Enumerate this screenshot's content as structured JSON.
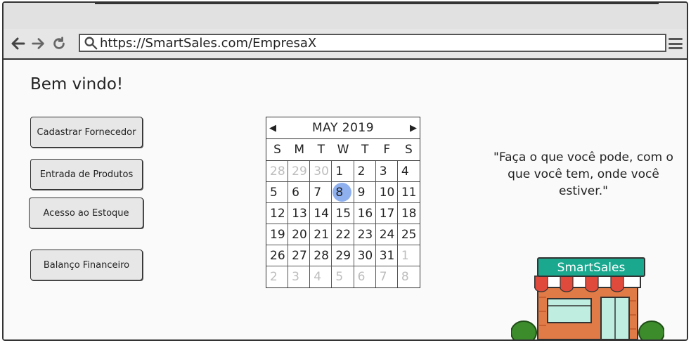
{
  "browser": {
    "url": "https://SmartSales.com/EmpresaX"
  },
  "page": {
    "welcome": "Bem vindo!",
    "buttons": [
      {
        "label": "Cadastrar Fornecedor"
      },
      {
        "label": "Entrada de Produtos"
      },
      {
        "label": "Acesso ao Estoque"
      },
      {
        "label": "Balanço Financeiro"
      }
    ],
    "quote": "\"Faça o que você pode, com o que você tem, onde você estiver.\"",
    "logo_text": "SmartSales"
  },
  "calendar": {
    "month_label": "MAY 2019",
    "weekdays": [
      "S",
      "M",
      "T",
      "W",
      "T",
      "F",
      "S"
    ],
    "weeks": [
      [
        "28",
        "29",
        "30",
        "1",
        "2",
        "3",
        "4"
      ],
      [
        "5",
        "6",
        "7",
        "8",
        "9",
        "10",
        "11"
      ],
      [
        "12",
        "13",
        "14",
        "15",
        "16",
        "17",
        "18"
      ],
      [
        "19",
        "20",
        "21",
        "22",
        "23",
        "24",
        "25"
      ],
      [
        "26",
        "27",
        "28",
        "29",
        "30",
        "31",
        "1"
      ],
      [
        "2",
        "3",
        "4",
        "5",
        "6",
        "7",
        "8"
      ]
    ],
    "selected_day": "8",
    "colors": {
      "selected": "#8fb0ef",
      "muted": "#bdbdbd"
    }
  },
  "colors": {
    "logo_bg": "#1aa88f",
    "awning_red": "#e04a3c",
    "brick": "#e07a46",
    "shrub": "#3c8c2c"
  }
}
